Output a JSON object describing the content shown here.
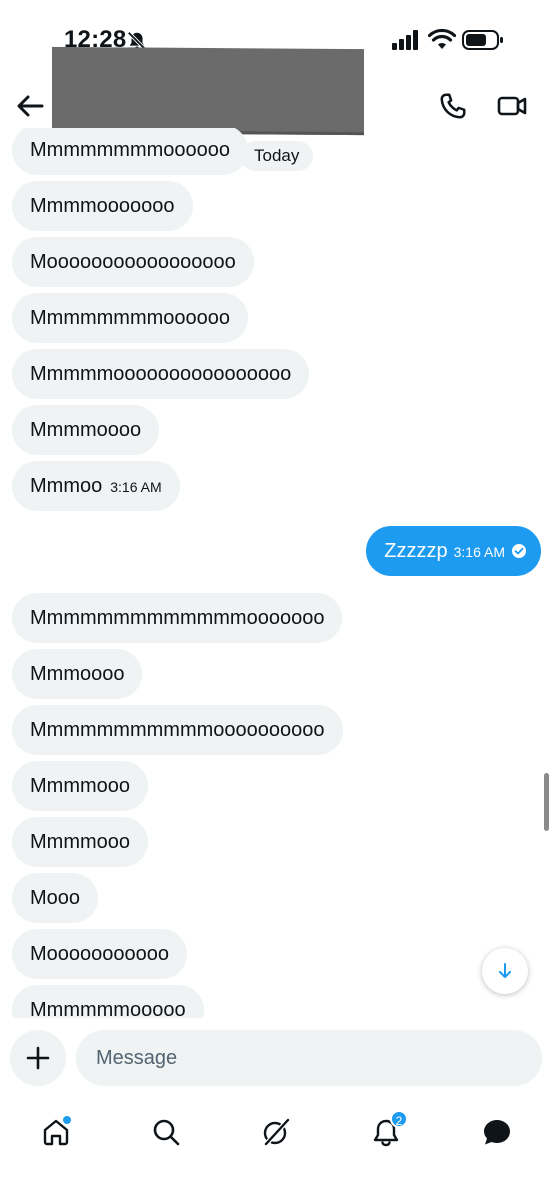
{
  "status_bar": {
    "time": "12:28"
  },
  "header": {
    "contact_name": ""
  },
  "day_divider": "Today",
  "messages": [
    {
      "text": "Mmmmmmmmoooooo"
    },
    {
      "text": "Mmmmooooooo"
    },
    {
      "text": "Mooooooooooooooooo"
    },
    {
      "text": "Mmmmmmmmoooooo"
    },
    {
      "text": "Mmmmmoooooooooooooooo"
    },
    {
      "text": "Mmmmoooo"
    },
    {
      "text": "Mmmoo",
      "time": "3:16 AM"
    },
    {
      "text": "Zzzzzp",
      "time": "3:16 AM",
      "sent": true
    },
    {
      "text": "Mmmmmmmmmmmmmooooooo"
    },
    {
      "text": "Mmmoooo"
    },
    {
      "text": "Mmmmmmmmmmmoooooooooo"
    },
    {
      "text": "Mmmmooo"
    },
    {
      "text": "Mmmmooo"
    },
    {
      "text": "Mooo"
    },
    {
      "text": "Mooooooooooo"
    },
    {
      "text": "Mmmmmmooooo"
    }
  ],
  "composer": {
    "placeholder": "Message"
  },
  "nav": {
    "notifications_badge": "2"
  },
  "colors": {
    "accent": "#1d9bf0",
    "bubble_received": "#eff3f4",
    "text": "#0f1419"
  }
}
